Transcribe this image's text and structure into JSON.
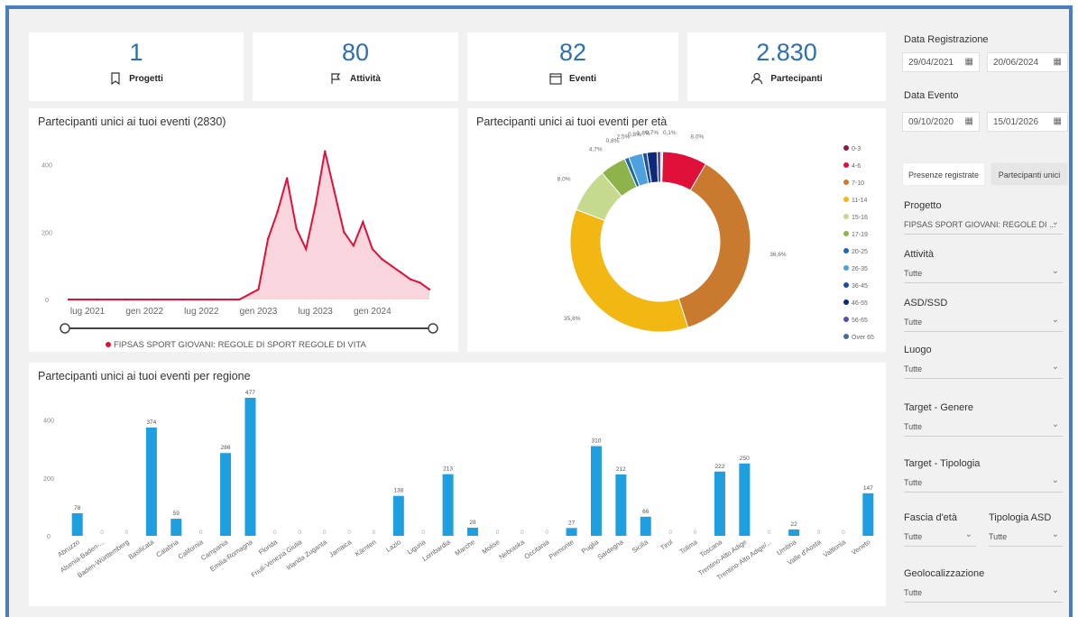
{
  "kpis": [
    {
      "value": "1",
      "label": "Progetti",
      "icon": "bookmark-icon"
    },
    {
      "value": "80",
      "label": "Attività",
      "icon": "flag-icon"
    },
    {
      "value": "82",
      "label": "Eventi",
      "icon": "calendar-icon"
    },
    {
      "value": "2.830",
      "label": "Partecipanti",
      "icon": "person-icon"
    }
  ],
  "colors": {
    "accent": "#2d6fb4",
    "bar": "#1f9ee0",
    "line": "#e0103a"
  },
  "line_chart": {
    "title": "Partecipanti unici ai tuoi eventi (2830)",
    "legend": "FIPSAS SPORT GIOVANI: REGOLE DI SPORT REGOLE DI VITA"
  },
  "donut_chart": {
    "title": "Partecipanti unici ai tuoi eventi per età"
  },
  "bar_chart": {
    "title": "Partecipanti unici ai tuoi eventi per regione"
  },
  "chart_data": [
    {
      "type": "line",
      "title": "Partecipanti unici ai tuoi eventi (2830)",
      "x_ticks": [
        "lug 2021",
        "gen 2022",
        "lug 2022",
        "gen 2023",
        "lug 2023",
        "gen 2024"
      ],
      "y_ticks": [
        0,
        200,
        400
      ],
      "ylim": [
        0,
        450
      ],
      "series": [
        {
          "name": "FIPSAS SPORT GIOVANI: REGOLE DI SPORT REGOLE DI VITA",
          "x": [
            "2021-05",
            "2021-08",
            "2021-11",
            "2022-02",
            "2022-05",
            "2022-08",
            "2022-11",
            "2023-01",
            "2023-02",
            "2023-03",
            "2023-04",
            "2023-05",
            "2023-06",
            "2023-07",
            "2023-08",
            "2023-09",
            "2023-10",
            "2023-11",
            "2023-12",
            "2024-01",
            "2024-02",
            "2024-03",
            "2024-04",
            "2024-05",
            "2024-06",
            "2024-07"
          ],
          "values": [
            0,
            0,
            0,
            0,
            0,
            0,
            0,
            30,
            180,
            260,
            360,
            210,
            150,
            280,
            440,
            320,
            200,
            160,
            230,
            150,
            120,
            100,
            80,
            60,
            50,
            30
          ]
        }
      ]
    },
    {
      "type": "pie",
      "title": "Partecipanti unici ai tuoi eventi per età",
      "categories": [
        "0-3",
        "4-6",
        "7-10",
        "11-14",
        "15-16",
        "17-19",
        "20-25",
        "26-35",
        "36-45",
        "46-55",
        "56-65",
        "Over 65"
      ],
      "values": [
        0.1,
        8.0,
        36.6,
        35.8,
        8.0,
        4.7,
        0.8,
        2.5,
        0.8,
        1.8,
        0.7,
        0.2
      ],
      "slice_labels": [
        "0,1%",
        "8,0%",
        "36,6%",
        "35,8%",
        "8,0%",
        "4,7%",
        "0,8%",
        "2,5%",
        "0,8%",
        "1,8%",
        "0,7%",
        ""
      ],
      "colors": [
        "#8b1b3c",
        "#e0103a",
        "#c97a2e",
        "#f2b712",
        "#c6da8e",
        "#8db34a",
        "#1f6aa8",
        "#4ea0e0",
        "#1c4fa3",
        "#0d2a7a",
        "#5b4ea8",
        "#4b6a9a"
      ],
      "legend_position": "right"
    },
    {
      "type": "bar",
      "title": "Partecipanti unici ai tuoi eventi per regione",
      "categories": [
        "Abruzzo",
        "Alsenia-Baden-...",
        "Baden-Württemberg",
        "Basilicata",
        "Calabria",
        "California",
        "Campania",
        "Emilia-Romagna",
        "Florida",
        "Friuli-Venezia Giulia",
        "Irlanda Zuganta",
        "Jamaica",
        "Kärnten",
        "Lazio",
        "Liguria",
        "Lombardia",
        "Marche",
        "Molise",
        "Nebraska",
        "Occitania",
        "Piemonte",
        "Puglia",
        "Sardegna",
        "Sicilia",
        "Tirol",
        "Tolima",
        "Toscana",
        "Trentino-Alto Adige",
        "Trentino-Alto Adige/...",
        "Umbria",
        "Valle d'Aosta",
        "Valtlonia",
        "Veneto"
      ],
      "values": [
        78,
        0,
        0,
        374,
        59,
        0,
        286,
        477,
        0,
        0,
        0,
        0,
        0,
        138,
        0,
        213,
        28,
        0,
        0,
        0,
        27,
        310,
        212,
        66,
        0,
        0,
        222,
        250,
        0,
        22,
        0,
        0,
        147
      ],
      "y_ticks": [
        0,
        200,
        400
      ],
      "ylim": [
        0,
        480
      ]
    }
  ],
  "sidebar": {
    "data_registrazione": {
      "label": "Data Registrazione",
      "from": "29/04/2021",
      "to": "20/06/2024"
    },
    "data_evento": {
      "label": "Data Evento",
      "from": "09/10/2020",
      "to": "15/01/2026"
    },
    "tabs": [
      "Presenze registrate",
      "Partecipanti unici"
    ],
    "filters": [
      {
        "label": "Progetto",
        "value": "FIPSAS SPORT GIOVANI: REGOLE DI ..."
      },
      {
        "label": "Attività",
        "value": "Tutte"
      },
      {
        "label": "ASD/SSD",
        "value": "Tutte"
      },
      {
        "label": "Luogo",
        "value": "Tutte"
      },
      {
        "label": "Target - Genere",
        "value": "Tutte"
      },
      {
        "label": "Target - Tipologia",
        "value": "Tutte"
      }
    ],
    "fascia": {
      "label": "Fascia d'età",
      "value": "Tutte"
    },
    "tipologia": {
      "label": "Tipologia ASD",
      "value": "Tutte"
    },
    "geo": {
      "label": "Geolocalizzazione",
      "value": "Tutte"
    }
  }
}
